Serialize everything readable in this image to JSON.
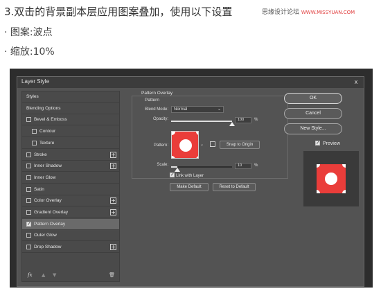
{
  "article": {
    "step_title": "3.双击的背景副本层应用图案叠加，使用以下设置",
    "watermark_left": "思缘设计论坛",
    "watermark_right": "WWW.MISSYUAN.COM",
    "bullet_pattern": "· 图案:波点",
    "bullet_scale": "· 缩放:10%"
  },
  "dialog": {
    "title": "Layer Style",
    "close_label": "x"
  },
  "styles_panel": {
    "items": [
      {
        "label": "Styles",
        "checkbox": false,
        "checked": false,
        "plus": false,
        "indent": 0,
        "active": false
      },
      {
        "label": "Blending Options",
        "checkbox": false,
        "checked": false,
        "plus": false,
        "indent": 0,
        "active": false
      },
      {
        "label": "Bevel & Emboss",
        "checkbox": true,
        "checked": false,
        "plus": false,
        "indent": 0,
        "active": false
      },
      {
        "label": "Contour",
        "checkbox": true,
        "checked": false,
        "plus": false,
        "indent": 1,
        "active": false
      },
      {
        "label": "Texture",
        "checkbox": true,
        "checked": false,
        "plus": false,
        "indent": 1,
        "active": false
      },
      {
        "label": "Stroke",
        "checkbox": true,
        "checked": false,
        "plus": true,
        "indent": 0,
        "active": false
      },
      {
        "label": "Inner Shadow",
        "checkbox": true,
        "checked": false,
        "plus": true,
        "indent": 0,
        "active": false
      },
      {
        "label": "Inner Glow",
        "checkbox": true,
        "checked": false,
        "plus": false,
        "indent": 0,
        "active": false
      },
      {
        "label": "Satin",
        "checkbox": true,
        "checked": false,
        "plus": false,
        "indent": 0,
        "active": false
      },
      {
        "label": "Color Overlay",
        "checkbox": true,
        "checked": false,
        "plus": true,
        "indent": 0,
        "active": false
      },
      {
        "label": "Gradient Overlay",
        "checkbox": true,
        "checked": false,
        "plus": true,
        "indent": 0,
        "active": false
      },
      {
        "label": "Pattern Overlay",
        "checkbox": true,
        "checked": true,
        "plus": false,
        "indent": 0,
        "active": true
      },
      {
        "label": "Outer Glow",
        "checkbox": true,
        "checked": false,
        "plus": false,
        "indent": 0,
        "active": false
      },
      {
        "label": "Drop Shadow",
        "checkbox": true,
        "checked": false,
        "plus": true,
        "indent": 0,
        "active": false
      }
    ],
    "fx_label": "fx",
    "up_arrow": "▲",
    "down_arrow": "▼",
    "trash_icon": "🗑"
  },
  "pattern_overlay": {
    "group_title": "Pattern Overlay",
    "sub_title": "Pattern",
    "blend_mode_label": "Blend Mode:",
    "blend_mode_value": "Normal",
    "opacity_label": "Opacity:",
    "opacity_value": "100",
    "opacity_unit": "%",
    "opacity_fraction": 1.0,
    "pattern_label": "Pattern:",
    "snap_button": "Snap to Origin",
    "scale_label": "Scale:",
    "scale_value": "10",
    "scale_unit": "%",
    "scale_fraction": 0.1,
    "link_label": "Link with Layer",
    "link_checked": true,
    "make_default": "Make Default",
    "reset_default": "Reset to Default",
    "pattern_color": "#ea3d3a"
  },
  "right_panel": {
    "ok": "OK",
    "cancel": "Cancel",
    "new_style": "New Style...",
    "preview_label": "Preview",
    "preview_checked": true
  }
}
